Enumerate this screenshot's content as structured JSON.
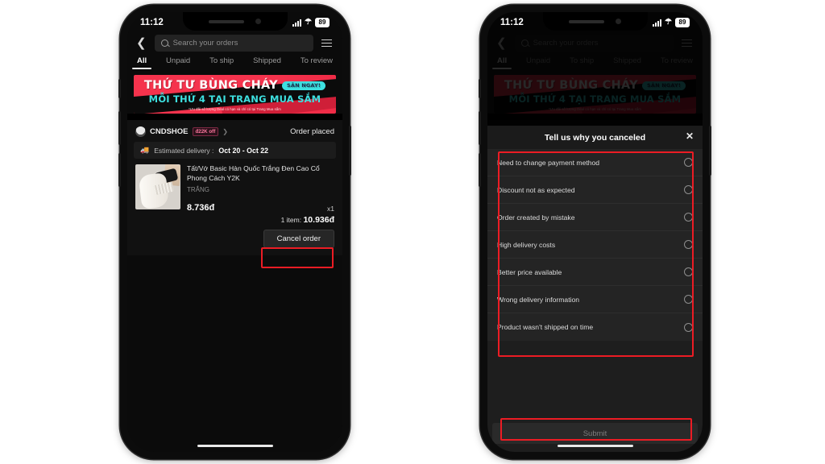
{
  "status_bar": {
    "time": "11:12",
    "battery": "89",
    "wifi_icon": "wifi-icon",
    "signal_icon": "cellular-signal-icon"
  },
  "app_header": {
    "back_icon": "chevron-left-icon",
    "search_placeholder": "Search your orders",
    "search_icon": "search-icon",
    "menu_icon": "hamburger-menu-icon"
  },
  "tabs": [
    {
      "label": "All",
      "active": true
    },
    {
      "label": "Unpaid",
      "active": false
    },
    {
      "label": "To ship",
      "active": false
    },
    {
      "label": "Shipped",
      "active": false
    },
    {
      "label": "To review",
      "active": false
    }
  ],
  "banner": {
    "line1": "THỨ TƯ BÙNG CHÁY",
    "pill": "SĂN NGAY!",
    "line2": "MỖI THỨ 4 TẠI TRANG MUA SẮM",
    "fine_print": "*Ưu đãi số lượng Deal có hạn và chỉ có tại Trang Mua sắm",
    "bg_color": "#f5334d",
    "accent_color": "#3de0e0"
  },
  "order": {
    "shop_name": "CNDSHOE",
    "shop_badge": "đ22K off",
    "shop_badge_color": "#ff79a0",
    "chevron_icon": "chevron-right-icon",
    "avatar_icon": "shop-avatar",
    "status": "Order placed",
    "eta_icon": "delivery-truck-icon",
    "eta_label": "Estimated delivery :",
    "eta_value": "Oct 20 - Oct 22",
    "item": {
      "title": "Tất/Vớ Basic Hàn Quốc Trắng Đen Cao Cổ Phong Cách Y2K",
      "variant": "TRẮNG",
      "price": "8.736đ",
      "qty": "x1",
      "thumbnail_icon": "product-thumbnail-socks"
    },
    "total_label": "1 item:",
    "total_value": "10.936đ",
    "cancel_button": "Cancel order"
  },
  "cancel_modal": {
    "title": "Tell us why you canceled",
    "close_icon": "close-x-icon",
    "reasons": [
      "Need to change payment method",
      "Discount not as expected",
      "Order created by mistake",
      "High delivery costs",
      "Better price available",
      "Wrong delivery information",
      "Product wasn't shipped on time"
    ],
    "submit_label": "Submit"
  },
  "annotations": {
    "highlight_color": "#ec1c24"
  }
}
